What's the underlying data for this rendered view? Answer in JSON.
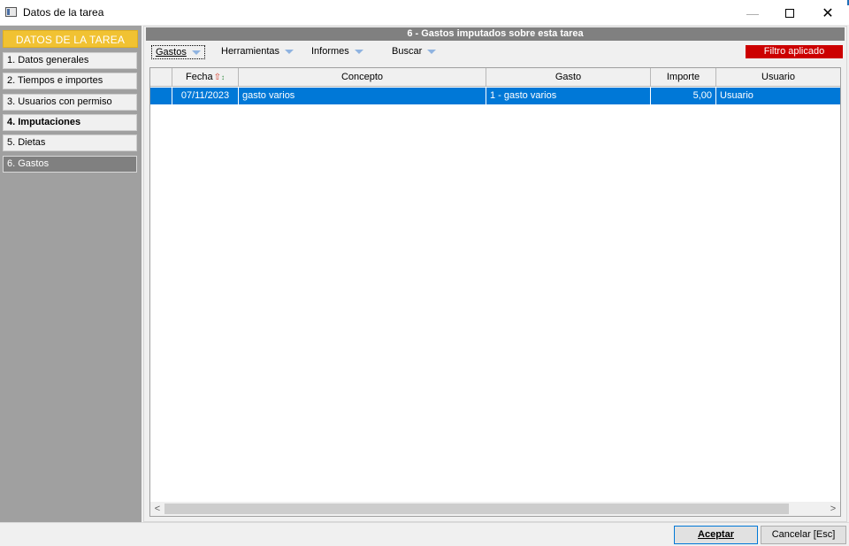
{
  "window": {
    "title": "Datos de la tarea",
    "min_glyph": "—",
    "close_glyph": "✕"
  },
  "sidebar": {
    "header": "DATOS DE LA TAREA",
    "items": [
      {
        "label": "1. Datos generales",
        "state": "normal"
      },
      {
        "label": "2. Tiempos e importes",
        "state": "normal"
      },
      {
        "label": "3. Usuarios con permiso",
        "state": "normal"
      },
      {
        "label": "4. Imputaciones",
        "state": "bold"
      },
      {
        "label": "5. Dietas",
        "state": "normal"
      },
      {
        "label": "6. Gastos",
        "state": "active"
      }
    ]
  },
  "panel": {
    "title": "6 - Gastos imputados sobre esta tarea"
  },
  "menus": [
    {
      "label": "Gastos",
      "focused": true
    },
    {
      "label": "Herramientas",
      "focused": false
    },
    {
      "label": "Informes",
      "focused": false
    },
    {
      "label": "Buscar",
      "focused": false
    }
  ],
  "filter_badge": "Filtro aplicado",
  "table": {
    "columns": [
      "Fecha",
      "Concepto",
      "Gasto",
      "Importe",
      "Usuario"
    ],
    "rows": [
      {
        "fecha": "07/11/2023",
        "concepto": "gasto varios",
        "gasto": "1 - gasto varios",
        "importe": "5,00",
        "usuario": "Usuario",
        "selected": true
      }
    ]
  },
  "scroll": {
    "left": "<",
    "right": ">"
  },
  "buttons": {
    "accept": "Aceptar",
    "cancel": "Cancelar [Esc]"
  },
  "colors": {
    "sidebar_header": "#f1c232",
    "selection": "#0078d7",
    "filter": "#cc0000",
    "panel_title": "#808080"
  }
}
